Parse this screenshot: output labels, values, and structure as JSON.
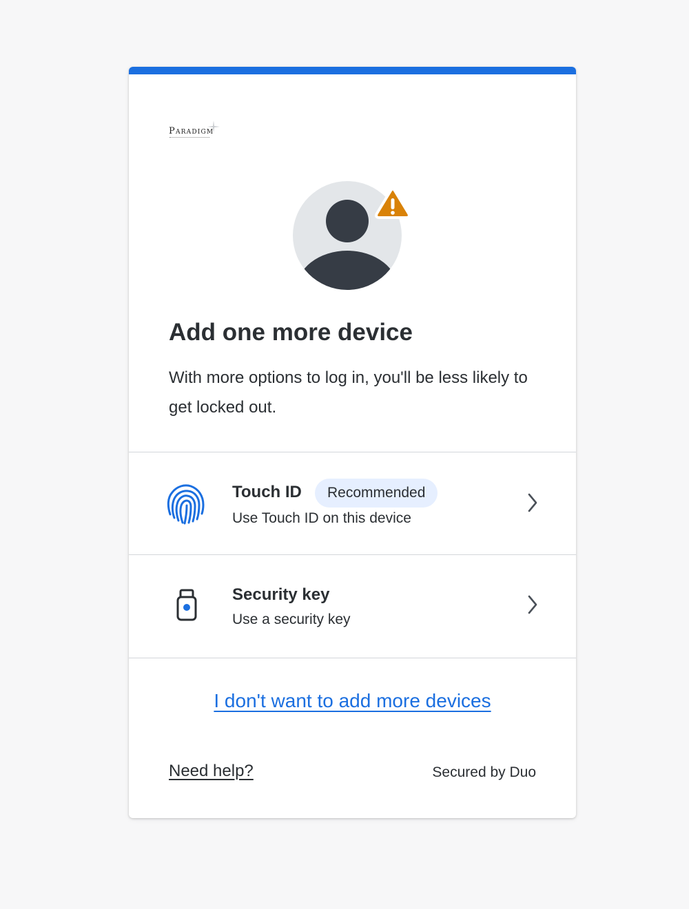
{
  "brand": {
    "logo_text": "Paradigm",
    "accent_color": "#1b6fe0",
    "warning_color": "#d98208"
  },
  "main": {
    "title": "Add one more device",
    "description": "With more options to log in, you'll be less likely to get locked out."
  },
  "options": [
    {
      "title": "Touch ID",
      "badge": "Recommended",
      "subtitle": "Use Touch ID on this device",
      "icon": "fingerprint-icon"
    },
    {
      "title": "Security key",
      "subtitle": "Use a security key",
      "icon": "security-key-icon"
    }
  ],
  "footer": {
    "skip_link": "I don't want to add more devices",
    "help_link": "Need help?",
    "secured_by": "Secured by Duo"
  }
}
